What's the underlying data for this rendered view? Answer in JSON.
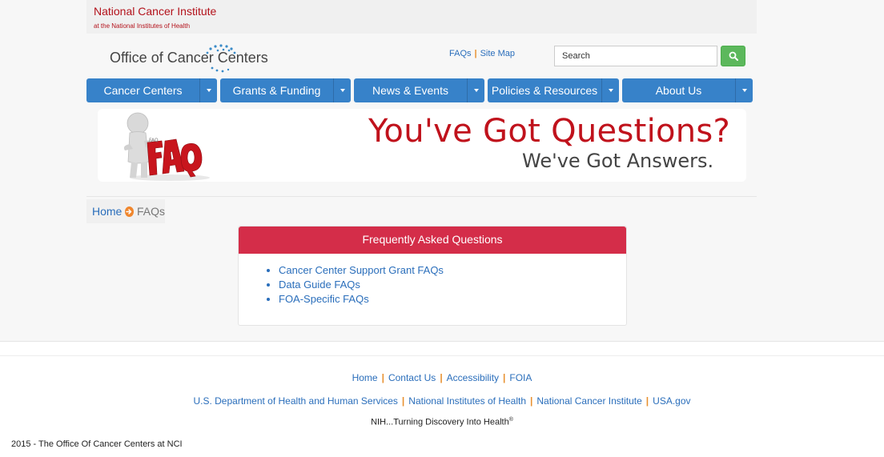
{
  "agency": {
    "title": "National Cancer Institute",
    "subtitle": "at the National Institutes of Health"
  },
  "header": {
    "logo_text_1": "Office of ",
    "logo_text_2": "Cancer Centers",
    "links": [
      {
        "label": "FAQs"
      },
      {
        "label": "Site Map"
      }
    ],
    "search": {
      "value": "Search",
      "icon": "search-icon"
    }
  },
  "nav": {
    "items": [
      {
        "label": "Cancer Centers"
      },
      {
        "label": "Grants & Funding"
      },
      {
        "label": "News & Events"
      },
      {
        "label": "Policies & Resources"
      },
      {
        "label": "About Us"
      }
    ]
  },
  "banner": {
    "figure_text": "FAQ",
    "headline": "You've Got Questions?",
    "subline": "We've Got Answers."
  },
  "breadcrumb": {
    "home": "Home",
    "current": "FAQs"
  },
  "faq_panel": {
    "title": "Frequently Asked Questions",
    "items": [
      {
        "label": "Cancer Center Support Grant FAQs"
      },
      {
        "label": "Data Guide FAQs"
      },
      {
        "label": "FOA-Specific FAQs"
      }
    ]
  },
  "footer": {
    "row1": [
      {
        "label": "Home"
      },
      {
        "label": "Contact Us"
      },
      {
        "label": "Accessibility"
      },
      {
        "label": "FOIA"
      }
    ],
    "row2": [
      {
        "label": "U.S. Department of Health and Human Services"
      },
      {
        "label": "National Institutes of Health"
      },
      {
        "label": "National Cancer Institute"
      },
      {
        "label": "USA.gov"
      }
    ],
    "tagline": "NIH...Turning Discovery Into Health",
    "tagline_mark": "®",
    "copyright": "2015 - The Office Of Cancer Centers at NCI"
  },
  "colors": {
    "nci_red": "#b3121b",
    "nav_blue": "#3782c9",
    "panel_red": "#d42d49",
    "link_blue": "#2a6ebb",
    "separator_orange": "#e8902e",
    "search_green": "#5cb85c"
  }
}
